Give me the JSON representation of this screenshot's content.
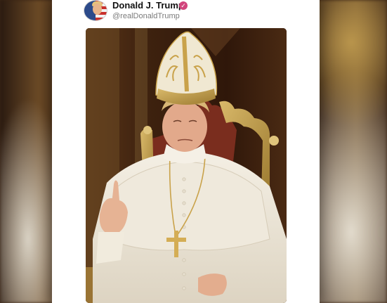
{
  "post": {
    "author_name": "Donald J. Trump",
    "author_handle": "@realDonaldTrump",
    "verified_icon": "verified-badge-icon",
    "avatar_icon": "avatar-flag-portrait"
  },
  "image": {
    "subject_icon": "pope-portrait-image"
  },
  "colors": {
    "verified_badge": "#d1457c",
    "card_background": "#ffffff",
    "handle_text": "#7a7a7a"
  }
}
